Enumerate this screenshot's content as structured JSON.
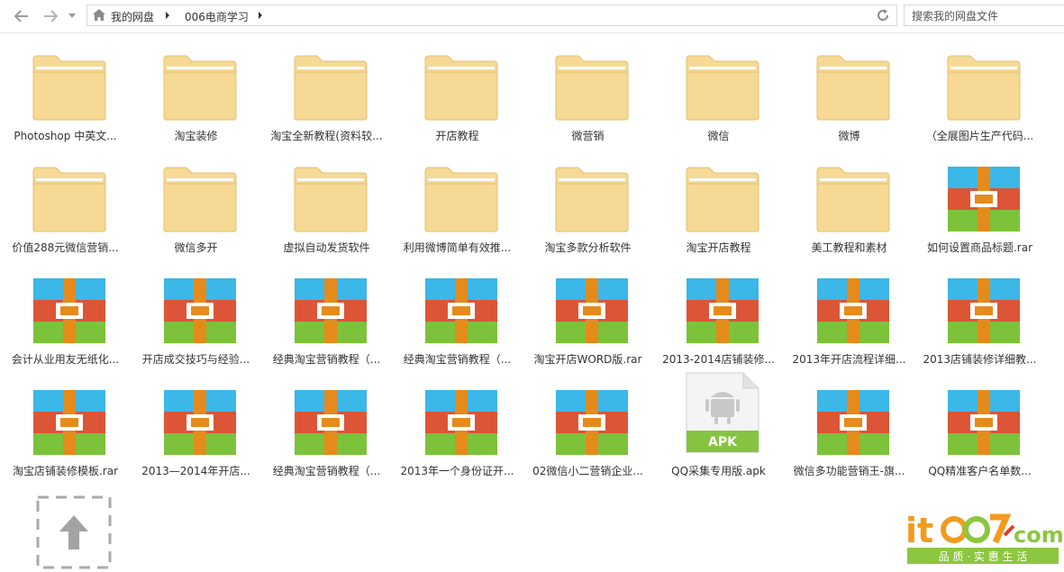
{
  "nav": {
    "back_icon": "back-arrow-icon",
    "forward_icon": "forward-arrow-icon",
    "history_icon": "chevron-down-icon"
  },
  "breadcrumb": [
    "我的网盘",
    "006电商学习"
  ],
  "search": {
    "placeholder": "搜索我的网盘文件"
  },
  "colors": {
    "folder": "#f6d994",
    "folder_edge": "#e3c070",
    "rar_blue": "#3bb7e8",
    "rar_red": "#dc5536",
    "rar_green": "#7cc23a",
    "rar_strap": "#e58b1b",
    "apk_green": "#86c440"
  },
  "files": [
    {
      "name": "Photoshop 中英文...",
      "type": "folder"
    },
    {
      "name": "淘宝装修",
      "type": "folder"
    },
    {
      "name": "淘宝全新教程(资料较...",
      "type": "folder"
    },
    {
      "name": "开店教程",
      "type": "folder"
    },
    {
      "name": "微营销",
      "type": "folder"
    },
    {
      "name": "微信",
      "type": "folder"
    },
    {
      "name": "微博",
      "type": "folder"
    },
    {
      "name": "（全展图片生产代码...",
      "type": "folder"
    },
    {
      "name": "价值288元微信营销...",
      "type": "folder"
    },
    {
      "name": "微信多开",
      "type": "folder"
    },
    {
      "name": "虚拟自动发货软件",
      "type": "folder"
    },
    {
      "name": "利用微博简单有效推...",
      "type": "folder"
    },
    {
      "name": "淘宝多款分析软件",
      "type": "folder"
    },
    {
      "name": "淘宝开店教程",
      "type": "folder"
    },
    {
      "name": "美工教程和素材",
      "type": "folder"
    },
    {
      "name": "如何设置商品标题.rar",
      "type": "rar"
    },
    {
      "name": "会计从业用友无纸化...",
      "type": "rar"
    },
    {
      "name": "开店成交技巧与经验...",
      "type": "rar"
    },
    {
      "name": "经典淘宝营销教程（...",
      "type": "rar"
    },
    {
      "name": "经典淘宝营销教程（...",
      "type": "rar"
    },
    {
      "name": "淘宝开店WORD版.rar",
      "type": "rar"
    },
    {
      "name": "2013-2014店铺装修...",
      "type": "rar"
    },
    {
      "name": "2013年开店流程详细...",
      "type": "rar"
    },
    {
      "name": "2013店铺装修详细教...",
      "type": "rar"
    },
    {
      "name": "淘宝店铺装修模板.rar",
      "type": "rar"
    },
    {
      "name": "2013—2014年开店...",
      "type": "rar"
    },
    {
      "name": "经典淘宝营销教程（...",
      "type": "rar"
    },
    {
      "name": "2013年一个身份证开...",
      "type": "rar"
    },
    {
      "name": "02微信小二营销企业...",
      "type": "rar"
    },
    {
      "name": "QQ采集专用版.apk",
      "type": "apk",
      "badge": "APK"
    },
    {
      "name": "微信多功能营销王-旗...",
      "type": "rar"
    },
    {
      "name": "QQ精准客户名单数...",
      "type": "rar"
    }
  ],
  "upload": {
    "icon": "upload-arrow-icon"
  },
  "watermark": {
    "logo_text": "itbo7&com",
    "tagline": "品 质 · 实 惠 生 活"
  }
}
